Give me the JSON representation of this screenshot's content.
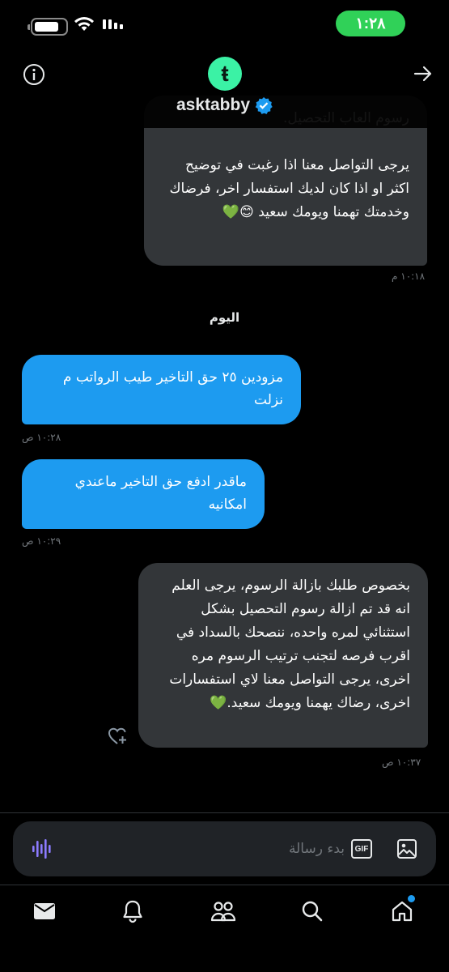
{
  "status_bar": {
    "time": "١:٢٨",
    "accent_color": "#30d158"
  },
  "header": {
    "name": "asktabby",
    "avatar_letter": "ŧ",
    "avatar_color": "#3bf2a5",
    "verified": true,
    "icons": [
      "info-icon",
      "arrow-right-icon",
      "verified-icon"
    ]
  },
  "messages": [
    {
      "side": "them",
      "text": "رسوم العاب التحصيل.\n\nيرجى التواصل معنا اذا رغبت في توضيح اكثر او اذا كان لديك استفسار اخر، فرضاك وخدمتك تهمنا ويومك سعيد 😊💚",
      "time": "١٠:١٨ م"
    },
    {
      "side": "me",
      "text": "مزودين ٢٥ حق التاخير طيب الرواتب م نزلت",
      "time": "١٠:٢٨ ص"
    },
    {
      "side": "me",
      "text": "ماقدر ادفع حق التاخير ماعندي امكانيه",
      "time": "١٠:٢٩ ص"
    },
    {
      "side": "them",
      "text": "بخصوص طلبك بازالة الرسوم، يرجى العلم انه قد تم ازالة رسوم التحصيل بشكل استثنائي لمره واحده، ننصحك بالسداد في اقرب فرصه لتجنب ترتيب الرسوم مره اخرى، يرجى التواصل معنا لاي استفسارات اخرى، رضاك يهمنا ويومك سعيد.💚",
      "time": "١٠:٣٧ ص"
    }
  ],
  "day_separator": "اليوم",
  "composer": {
    "placeholder": "بدء رسالة",
    "gif_label": "GIF",
    "icons": [
      "voice-icon",
      "gif-icon",
      "image-icon"
    ]
  },
  "nav": {
    "items": [
      "messages-icon",
      "notifications-icon",
      "communities-icon",
      "search-icon",
      "home-icon"
    ],
    "badge_color": "#1d9bf0"
  },
  "colors": {
    "bubble_me": "#1d9bf0",
    "bubble_them": "#333639",
    "background": "#000000"
  }
}
